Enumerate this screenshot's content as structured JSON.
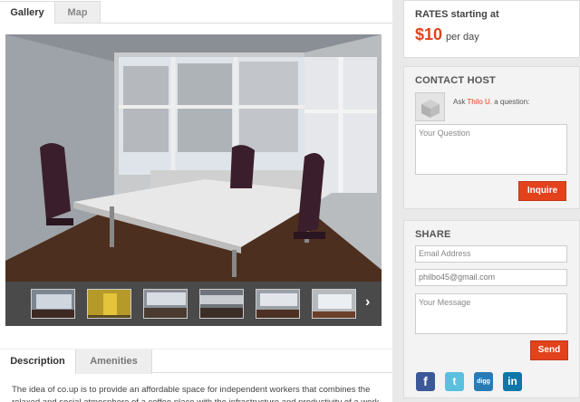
{
  "gallery_tabs": {
    "gallery": "Gallery",
    "map": "Map"
  },
  "thumb_arrow": "›",
  "description_tabs": {
    "description": "Description",
    "amenities": "Amenities"
  },
  "description_text": "The idea of co.up is to provide an affordable space for independent workers that combines the relaxed and social atmosphere of a coffee place with the infrastructure and productivity of a work place",
  "rates": {
    "title": "RATES starting at",
    "price": "$10",
    "unit": "per day"
  },
  "contact": {
    "title": "CONTACT HOST",
    "ask_prefix": "Ask",
    "host_name": "Thilo U.",
    "ask_suffix": "a question:",
    "question_placeholder": "Your Question",
    "inquire_label": "Inquire"
  },
  "share": {
    "title": "SHARE",
    "email_placeholder": "Email Address",
    "sender_email": "philbo45@gmail.com",
    "message_placeholder": "Your Message",
    "send_label": "Send",
    "social_icons": [
      "facebook-icon",
      "twitter-icon",
      "digg-icon",
      "linkedin-icon"
    ]
  },
  "colors": {
    "accent": "#e2421c",
    "facebook": "#3b5998",
    "twitter": "#5bc0de",
    "digg": "#2a7bb3",
    "linkedin": "#0e76a8"
  }
}
